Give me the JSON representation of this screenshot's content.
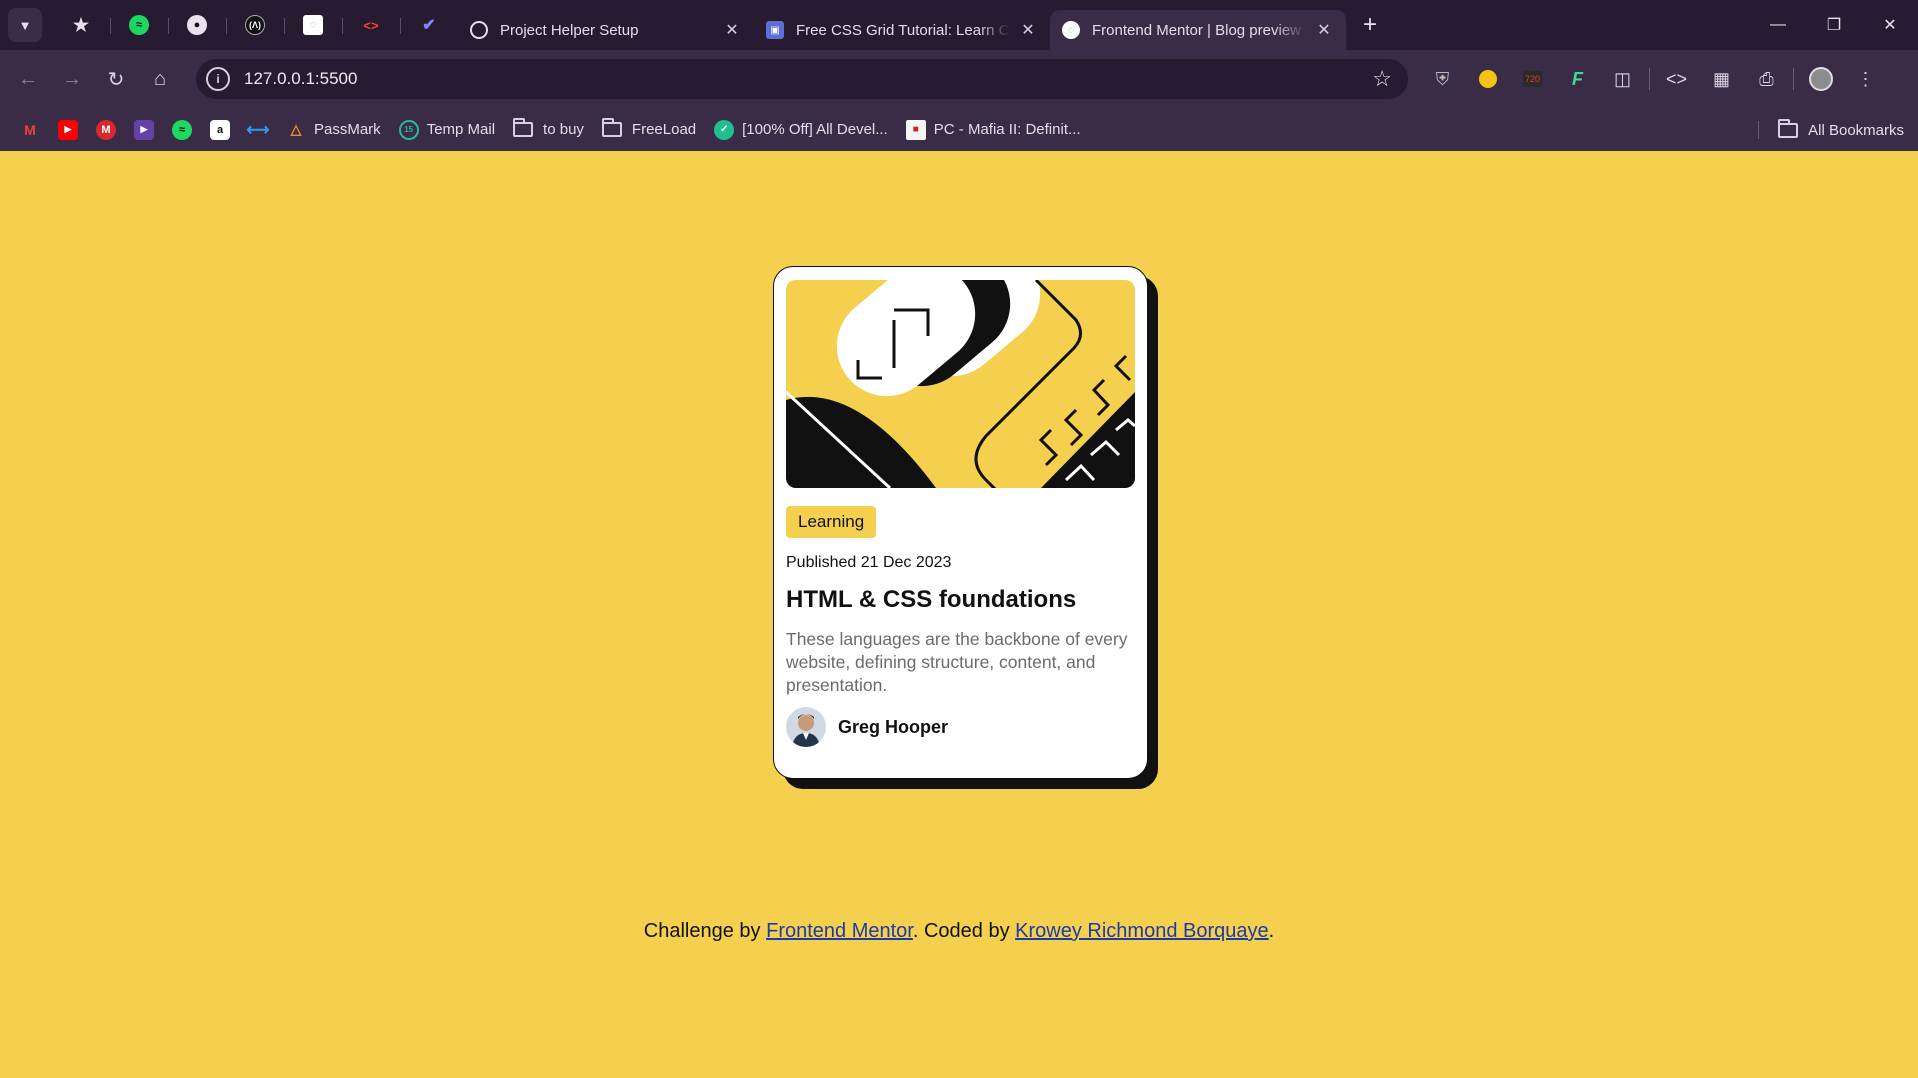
{
  "browser": {
    "tabs": [
      {
        "title": "Project Helper Setup",
        "favicon": "openai-icon"
      },
      {
        "title": "Free CSS Grid Tutorial: Learn CSS Grid",
        "favicon": "scrimba-icon"
      },
      {
        "title": "Frontend Mentor | Blog preview card",
        "favicon": "frontend-mentor-icon",
        "active": true
      }
    ],
    "url": "127.0.0.1:5500",
    "bookmarks": [
      {
        "label": "",
        "icon": "gmail-icon"
      },
      {
        "label": "",
        "icon": "youtube-icon"
      },
      {
        "label": "",
        "icon": "mega-icon"
      },
      {
        "label": "",
        "icon": "twitch-icon"
      },
      {
        "label": "",
        "icon": "spotify-icon"
      },
      {
        "label": "",
        "icon": "amazon-icon"
      },
      {
        "label": "",
        "icon": "vscode-icon"
      },
      {
        "label": "PassMark",
        "icon": "flame-icon"
      },
      {
        "label": "Temp Mail",
        "icon": "tempmail-icon"
      },
      {
        "label": "to buy",
        "icon": "folder-icon"
      },
      {
        "label": "FreeLoad",
        "icon": "folder-icon"
      },
      {
        "label": "[100% Off] All Devel...",
        "icon": "udemy-icon"
      },
      {
        "label": "PC - Mafia II: Definit...",
        "icon": "pdf-icon"
      }
    ],
    "all_bookmarks": "All Bookmarks"
  },
  "card": {
    "tag": "Learning",
    "published": "Published 21 Dec 2023",
    "title": "HTML & CSS foundations",
    "description": "These languages are the backbone of every website, defining structure, content, and presentation.",
    "author": "Greg Hooper"
  },
  "attribution": {
    "prefix": "Challenge by ",
    "link1": "Frontend Mentor",
    "middle": ". Coded by ",
    "link2": "Krowey Richmond Borquaye",
    "suffix": "."
  },
  "colors": {
    "page_bg": "#f4d04e",
    "chrome_dark": "#261b30",
    "chrome": "#3a2c47",
    "link": "#1e3aa8"
  }
}
